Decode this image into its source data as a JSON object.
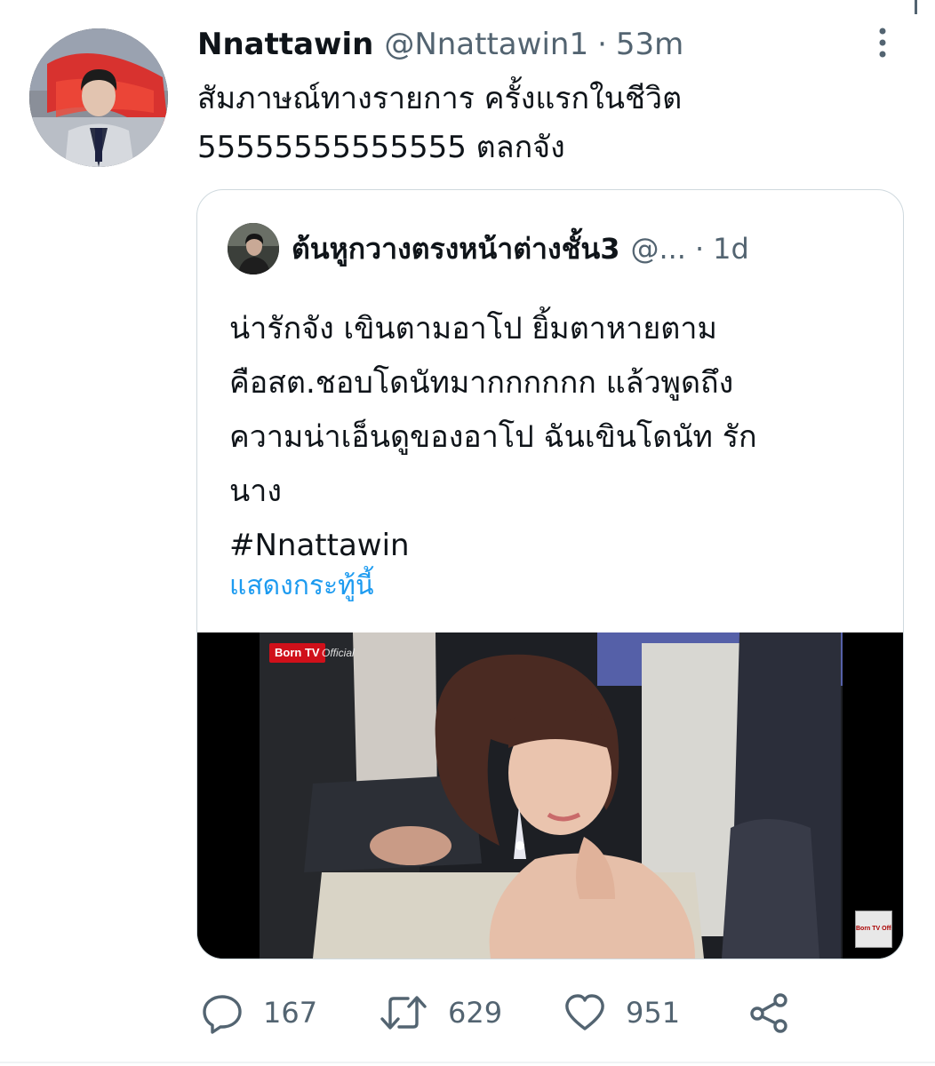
{
  "tweet": {
    "display_name": "Nnattawin",
    "handle": "@Nnattawin1",
    "separator": "·",
    "time": "53m",
    "text_lines": [
      "สัมภาษณ์ทางรายการ ครั้งแรกในชีวิต",
      "55555555555555 ตลกจัง"
    ]
  },
  "quote": {
    "display_name": "ต้นหูกวางตรงหน้าต่างชั้น3",
    "handle": "@...",
    "separator": "·",
    "time": "1d",
    "text_lines": [
      "น่ารักจัง เขินตามอาโป ยิ้มตาหายตาม",
      "คือสต.ชอบโดนัทมากกกกกก แล้วพูดถึง",
      "ความน่าเอ็นดูของอาโป ฉันเขินโดนัท รัก",
      "นาง",
      "#Nnattawin"
    ],
    "show_thread": "แสดงกระทู้นี้",
    "media": {
      "watermark": "Born TV",
      "watermark_suffix": "Official",
      "corner_logo": "Born TV Official"
    }
  },
  "actions": {
    "reply_count": "167",
    "retweet_count": "629",
    "like_count": "951"
  },
  "icons": {
    "reply": "reply-icon",
    "retweet": "retweet-icon",
    "like": "heart-icon",
    "share": "share-icon",
    "more": "more-vertical-icon"
  },
  "colors": {
    "text_primary": "#0f1419",
    "text_secondary": "#536471",
    "link": "#1d9bf0",
    "border": "#cfd9de",
    "watermark_red": "#d0101a"
  }
}
